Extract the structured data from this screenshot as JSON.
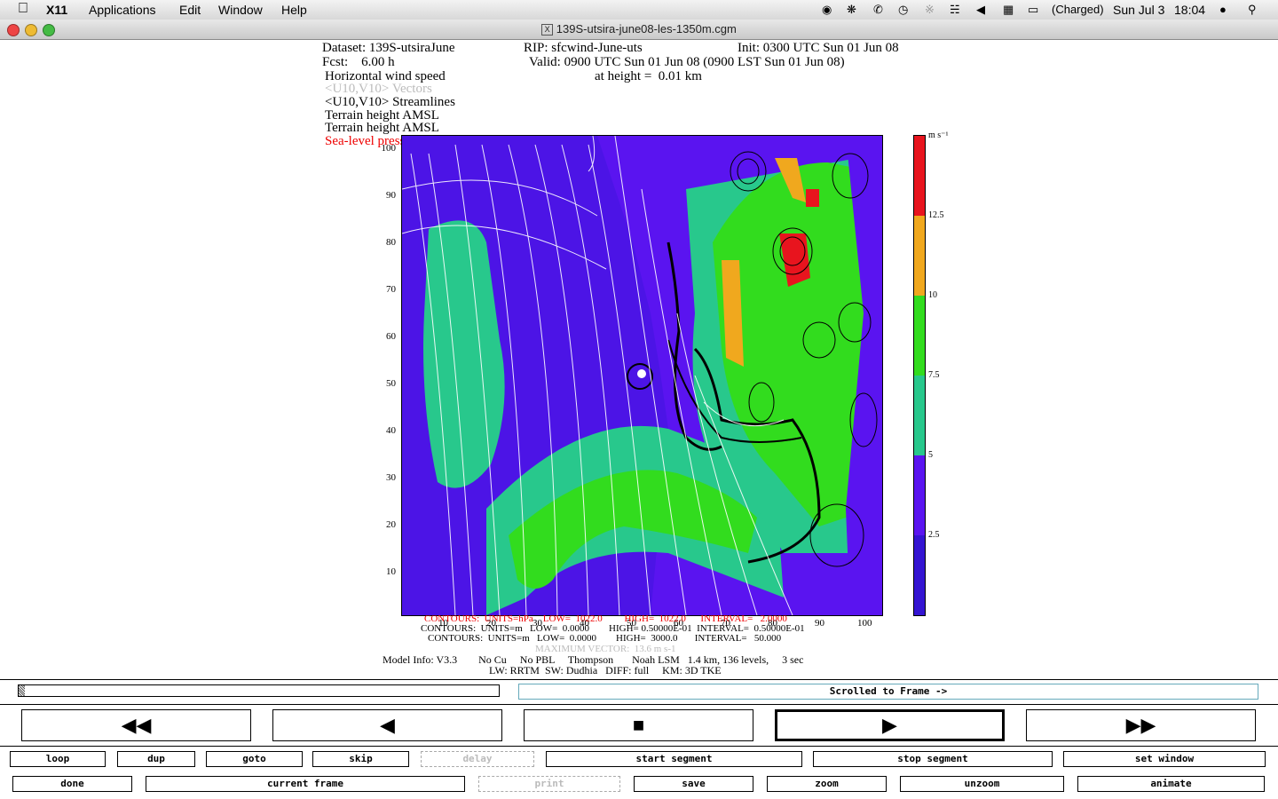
{
  "menubar": {
    "app": "X11",
    "items": [
      "Applications",
      "Edit",
      "Window",
      "Help"
    ],
    "battery": "(Charged)",
    "date": "Sun Jul 3",
    "time": "18:04"
  },
  "window": {
    "title": "139S-utsira-june08-les-1350m.cgm"
  },
  "plot_header": {
    "dataset": "Dataset: 139S-utsiraJune",
    "rip": "RIP: sfcwind-June-uts",
    "init": "Init: 0300 UTC Sun 01 Jun 08",
    "fcst": "Fcst:    6.00 h",
    "valid": "Valid: 0900 UTC Sun 01 Jun 08 (0900 LST Sun 01 Jun 08)",
    "height": "at height =  0.01 km",
    "field1": "Horizontal wind speed",
    "field2": "<U10,V10> Vectors",
    "field3": "<U10,V10> Streamlines",
    "field4": "Terrain height AMSL",
    "field5": "Terrain height AMSL",
    "field6": "Sea-level pressure"
  },
  "axes": {
    "y_ticks": [
      "100",
      "90",
      "80",
      "70",
      "60",
      "50",
      "40",
      "30",
      "20",
      "10"
    ],
    "x_ticks": [
      "10",
      "20",
      "30",
      "40",
      "50",
      "60",
      "70",
      "80",
      "90",
      "100"
    ]
  },
  "colorbar": {
    "unit": "m s⁻¹",
    "labels": [
      "12.5",
      "10",
      "7.5",
      "5",
      "2.5"
    ],
    "colors": [
      "#e8141e",
      "#f0a81e",
      "#32dc1e",
      "#28c88c",
      "#5a14f0",
      "#3414d2"
    ]
  },
  "footer": {
    "line1": "CONTOURS:  UNITS=hPa    LOW=  1022.0         HIGH=  1022.0      INTERVAL=   2.0000",
    "line2": "CONTOURS:  UNITS=m   LOW=  0.0000        HIGH= 0.50000E-01  INTERVAL=  0.50000E-01",
    "line3": "CONTOURS:  UNITS=m   LOW=  0.0000        HIGH=  3000.0       INTERVAL=   50.000",
    "line4": "MAXIMUM VECTOR:  13.6 m s-1",
    "line5": "Model Info: V3.3        No Cu     No PBL     Thompson       Noah LSM   1.4 km, 136 levels,     3 sec",
    "line6": "LW: RRTM  SW: Dudhia   DIFF: full     KM: 3D TKE"
  },
  "status": {
    "frame_text": "Scrolled to Frame ->"
  },
  "controls": {
    "loop": "loop",
    "dup": "dup",
    "goto": "goto",
    "skip": "skip",
    "delay": "delay",
    "start_segment": "start segment",
    "stop_segment": "stop segment",
    "set_window": "set window",
    "done": "done",
    "current_frame": "current frame",
    "print": "print",
    "save": "save",
    "zoom": "zoom",
    "unzoom": "unzoom",
    "animate": "animate"
  }
}
